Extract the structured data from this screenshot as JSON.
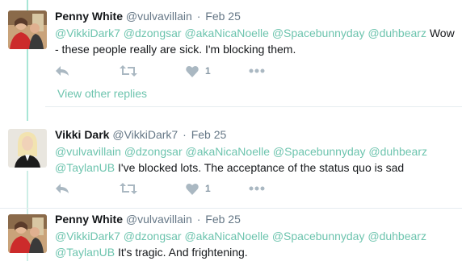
{
  "tweets": [
    {
      "name": "Penny White",
      "handle": "@vulvavillain",
      "date": "Feb 25",
      "mentions": [
        "@VikkiDark7",
        "@dzongsar",
        "@akaNicaNoelle",
        "@Spacebunnyday",
        "@duhbearz"
      ],
      "text": "Wow - these people really are sick. I'm blocking them.",
      "like_count": "1"
    },
    {
      "name": "Vikki Dark",
      "handle": "@VikkiDark7",
      "date": "Feb 25",
      "mentions": [
        "@vulvavillain",
        "@dzongsar",
        "@akaNicaNoelle",
        "@Spacebunnyday",
        "@duhbearz",
        "@TaylanUB"
      ],
      "text": "I've blocked lots. The acceptance of the status quo is sad",
      "like_count": "1"
    },
    {
      "name": "Penny White",
      "handle": "@vulvavillain",
      "date": "Feb 25",
      "mentions": [
        "@VikkiDark7",
        "@dzongsar",
        "@akaNicaNoelle",
        "@Spacebunnyday",
        "@duhbearz",
        "@TaylanUB"
      ],
      "text": "It's tragic. And frightening."
    }
  ],
  "view_other_replies": "View other replies",
  "separator_dot": "·",
  "icons": {
    "reply": "reply-icon",
    "retweet": "retweet-icon",
    "like": "heart-icon",
    "more": "more-icon"
  },
  "colors": {
    "accent": "#6dc4ae",
    "thread_line": "#a8e6d6",
    "muted": "#657786",
    "action_gray": "#aab8c2"
  }
}
